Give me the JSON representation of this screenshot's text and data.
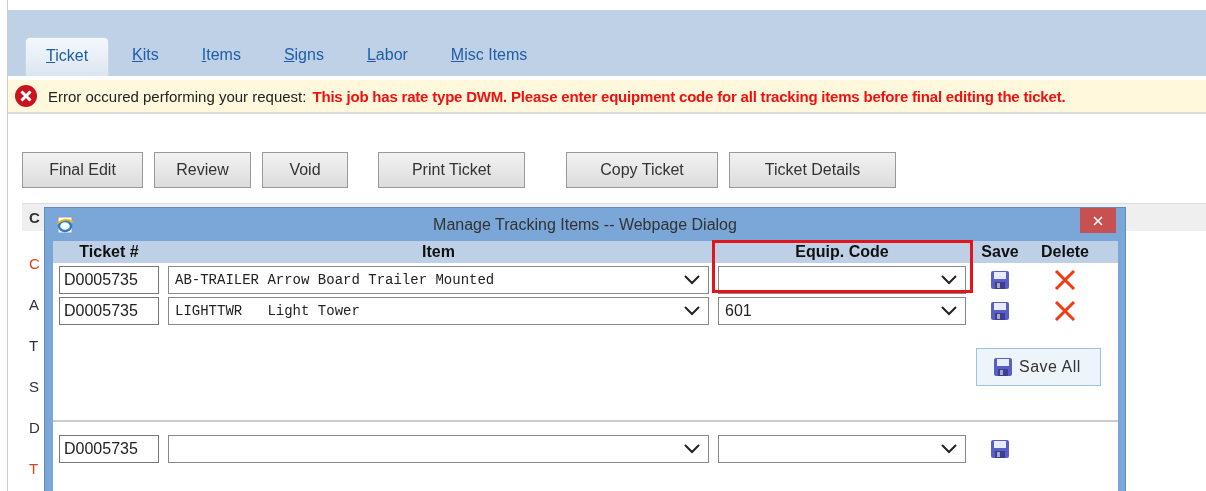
{
  "tabs": [
    {
      "label": "Ticket",
      "selected": true
    },
    {
      "label": "Kits",
      "selected": false
    },
    {
      "label": "Items",
      "selected": false
    },
    {
      "label": "Signs",
      "selected": false
    },
    {
      "label": "Labor",
      "selected": false
    },
    {
      "label": "Misc Items",
      "selected": false
    }
  ],
  "error": {
    "prefix": "Error occured performing your request:",
    "message": "This job has rate type DWM. Please enter equipment code for all tracking items before final editing the ticket."
  },
  "buttons": [
    "Final Edit",
    "Review",
    "Void",
    "Print Ticket",
    "Copy Ticket",
    "Ticket Details"
  ],
  "background_panel": {
    "header": "C",
    "letters": [
      {
        "text": "C",
        "color": "#d9441c"
      },
      {
        "text": "A",
        "color": "#333333"
      },
      {
        "text": "T",
        "color": "#333333"
      },
      {
        "text": "S",
        "color": "#333333"
      },
      {
        "text": "D",
        "color": "#333333"
      },
      {
        "text": "T",
        "color": "#d9441c"
      }
    ]
  },
  "dialog": {
    "title": "Manage Tracking Items -- Webpage Dialog",
    "columns": [
      {
        "label": "Ticket #",
        "highlighted": false
      },
      {
        "label": "Item",
        "highlighted": false
      },
      {
        "label": "Equip. Code",
        "highlighted": true
      },
      {
        "label": "Save",
        "highlighted": false
      },
      {
        "label": "Delete",
        "highlighted": false
      }
    ],
    "rows": [
      {
        "ticket": "D0005735",
        "item": "AB-TRAILER Arrow Board Trailer Mounted",
        "equip_code": ""
      },
      {
        "ticket": "D0005735",
        "item": "LIGHTTWR   Light Tower",
        "equip_code": "601"
      }
    ],
    "save_all": "Save All",
    "new_row": {
      "ticket": "D0005735"
    }
  }
}
